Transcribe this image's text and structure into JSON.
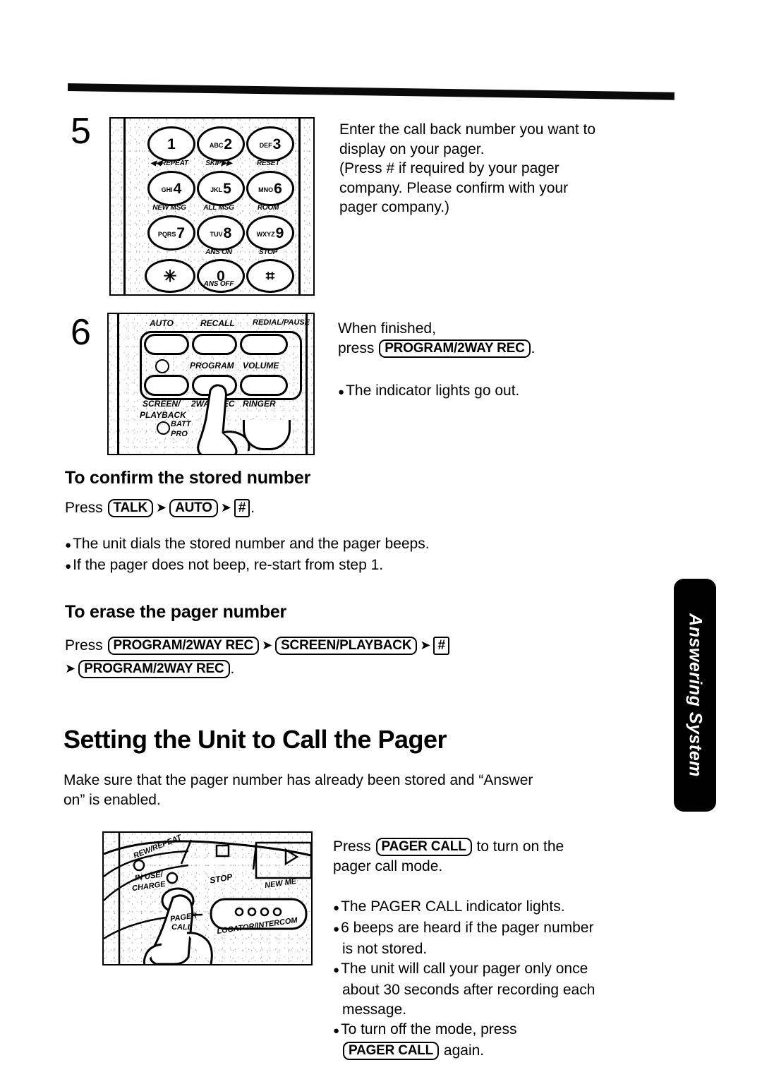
{
  "document": {
    "type": "manual-page",
    "side_tab_label": "Answering System"
  },
  "steps": [
    {
      "number": "5",
      "illustration": {
        "name": "handset-keypad",
        "keys": [
          {
            "letters": "",
            "digit": "1"
          },
          {
            "letters": "ABC",
            "digit": "2"
          },
          {
            "letters": "DEF",
            "digit": "3"
          },
          {
            "letters": "GHI",
            "digit": "4"
          },
          {
            "letters": "JKL",
            "digit": "5"
          },
          {
            "letters": "MNO",
            "digit": "6"
          },
          {
            "letters": "PQRS",
            "digit": "7"
          },
          {
            "letters": "TUV",
            "digit": "8"
          },
          {
            "letters": "WXYZ",
            "digit": "9"
          },
          {
            "letters": "",
            "digit": "✳"
          },
          {
            "letters": "",
            "digit": "0"
          },
          {
            "letters": "",
            "digit": "⌗"
          }
        ],
        "sub_labels": [
          "◀◀REPEAT",
          "SKIP▶▶",
          "RESET",
          "NEW MSG",
          "ALL MSG",
          "ROOM",
          "ANS ON",
          "STOP",
          "ANS OFF"
        ]
      },
      "text_lines": [
        "Enter the call back number you want to",
        "display on your pager.",
        "(Press # if required by your pager",
        "company. Please confirm with your",
        "pager company.)"
      ]
    },
    {
      "number": "6",
      "illustration": {
        "name": "base-unit-program-button",
        "labels": [
          "AUTO",
          "RECALL",
          "REDIAL/PAUSE",
          "PROGRAM",
          "VOLUME",
          "SCREEN/",
          "PLAYBACK",
          "2WAY REC",
          "RINGER",
          "BATT",
          "PRO"
        ]
      },
      "text_line_1": "When finished,",
      "text_line_2_prefix": "press ",
      "text_line_2_key": "PROGRAM/2WAY REC",
      "text_line_2_suffix": ".",
      "bullet": "The indicator lights go out."
    }
  ],
  "confirm_section": {
    "heading": "To confirm the stored number",
    "press_label": "Press",
    "keys": [
      "TALK",
      "AUTO",
      "#"
    ],
    "period": ".",
    "bullets": [
      "The unit dials the stored number and the pager beeps.",
      "If the pager does not beep, re-start from step 1."
    ]
  },
  "erase_section": {
    "heading": "To erase the pager number",
    "press_label": "Press",
    "keys_line1": [
      "PROGRAM/2WAY REC",
      "SCREEN/PLAYBACK",
      "#"
    ],
    "keys_line2": [
      "PROGRAM/2WAY REC"
    ],
    "period": "."
  },
  "pager_section": {
    "heading": "Setting the Unit to Call the Pager",
    "intro_lines": [
      "Make sure that the pager number has already been stored and “Answer",
      "on” is enabled."
    ],
    "illustration": {
      "name": "base-unit-pager-call-button",
      "labels": [
        "REW/REPEAT",
        "IN USE/",
        "CHARGE",
        "STOP",
        "NEW ME",
        "PAGER",
        "CALL",
        "LOCATOR/INTERCOM"
      ]
    },
    "instruction_prefix": "Press ",
    "instruction_key": "PAGER CALL",
    "instruction_suffix_line1": " to turn on the",
    "instruction_line2": "pager call mode.",
    "bullets": [
      {
        "text": "The PAGER CALL indicator lights."
      },
      {
        "text": "6 beeps are heard if the pager number"
      },
      {
        "text": "is not stored.",
        "continuation": true
      },
      {
        "text": "The unit will call your pager only once"
      },
      {
        "text": "about 30 seconds after recording each",
        "continuation": true
      },
      {
        "text": "message.",
        "continuation": true
      },
      {
        "text": "To turn off the mode, press"
      }
    ],
    "last_line_key": "PAGER CALL",
    "last_line_suffix": " again."
  },
  "colors": {
    "ink": "#000000",
    "paper": "#ffffff",
    "tab_background": "#000000",
    "tab_text": "#ffffff"
  }
}
